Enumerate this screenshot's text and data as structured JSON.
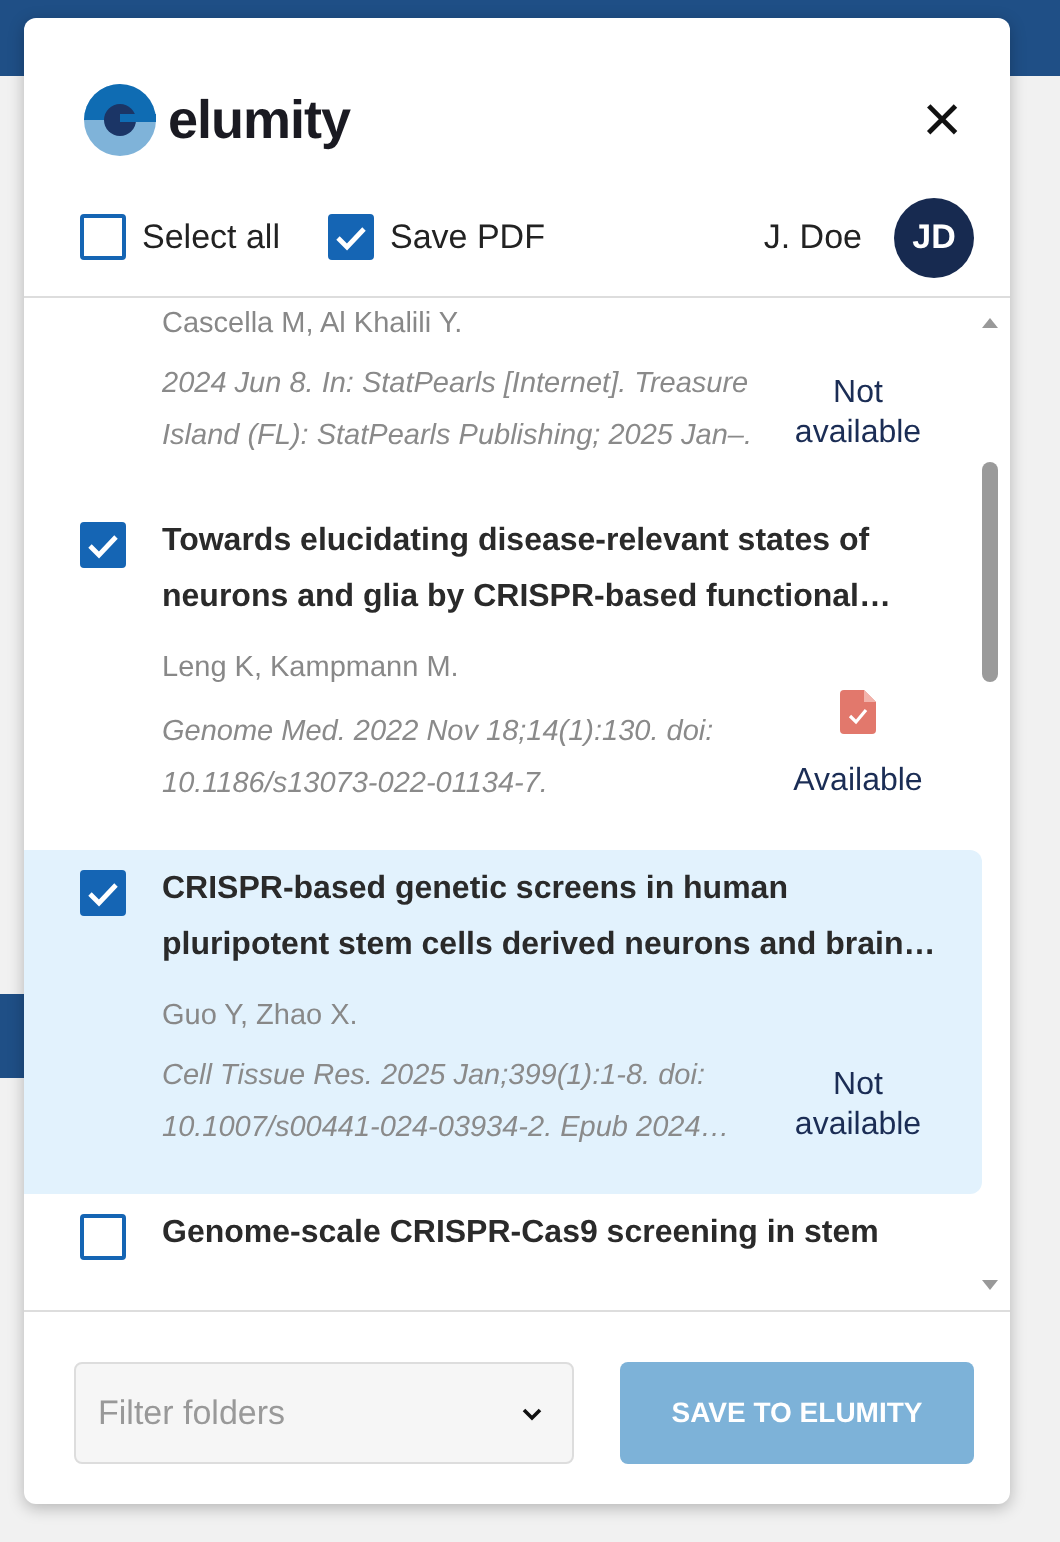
{
  "header": {
    "brand": "elumity",
    "close": "×"
  },
  "toolbar": {
    "select_all": {
      "label": "Select all",
      "checked": false
    },
    "save_pdf": {
      "label": "Save PDF",
      "checked": true
    },
    "user": "J. Doe",
    "initials": "JD"
  },
  "articles": [
    {
      "authors": "Cascella M, Al Khalili Y.",
      "citation": "2024 Jun 8. In: StatPearls [Internet]. Treasure Island (FL): StatPearls Publishing; 2025 Jan–.",
      "status": "Not available",
      "selected": false
    },
    {
      "checked": true,
      "selected": false,
      "title": "Towards elucidating disease-relevant states of neurons and glia by CRISPR-based functional…",
      "authors": "Leng K, Kampmann M.",
      "citation": "Genome Med. 2022 Nov 18;14(1):130. doi: 10.1186/s13073-022-01134-7.",
      "pdf_icon": true,
      "status": "Available"
    },
    {
      "checked": true,
      "selected": true,
      "title": "CRISPR-based genetic screens in human pluripotent stem cells derived neurons and brain…",
      "authors": "Guo Y, Zhao X.",
      "citation": "Cell Tissue Res. 2025 Jan;399(1):1-8. doi: 10.1007/s00441-024-03934-2. Epub 2024…",
      "status": "Not available"
    },
    {
      "checked": false,
      "selected": false,
      "title": "Genome-scale CRISPR-Cas9 screening in stem"
    }
  ],
  "footer": {
    "folder_placeholder": "Filter folders",
    "save_button": "SAVE TO ELUMITY"
  }
}
